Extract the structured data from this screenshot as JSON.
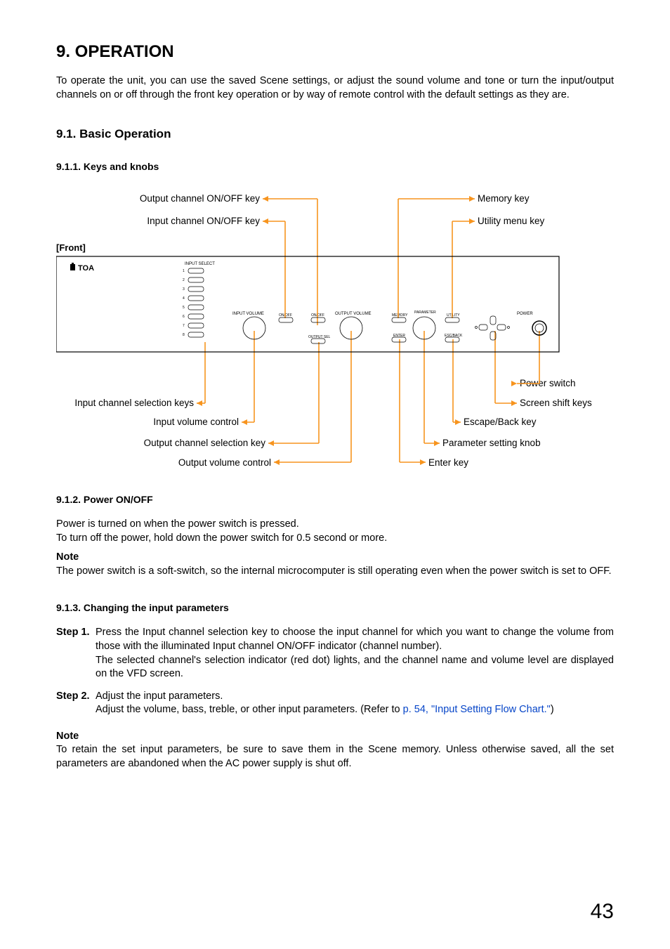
{
  "title": "9. OPERATION",
  "intro": "To operate the unit, you can use the saved Scene settings, or adjust the sound volume and tone or turn the input/output channels on or off through the front key operation or by way of remote control with the default settings as they are.",
  "s91": "9.1. Basic Operation",
  "s911": "9.1.1. Keys and knobs",
  "diagram": {
    "front": "[Front]",
    "brand": "TOA",
    "labels": {
      "outChOnOff": "Output channel ON/OFF key",
      "inChOnOff": "Input channel ON/OFF key",
      "memoryKey": "Memory key",
      "utilityKey": "Utility menu key",
      "inChSel": "Input channel selection keys",
      "inVol": "Input volume control",
      "outChSel": "Output channel selection key",
      "outVol": "Output volume control",
      "powerSw": "Power switch",
      "screenShift": "Screen shift keys",
      "escBack": "Escape/Back key",
      "paramKnob": "Parameter setting knob",
      "enterKey": "Enter key"
    },
    "panel": {
      "inputSelect": "INPUT SELECT",
      "nums": [
        "1",
        "2",
        "3",
        "4",
        "5",
        "6",
        "7",
        "8"
      ],
      "inputVolume": "INPUT VOLUME",
      "onOffL": "ON/OFF",
      "onOffR": "ON/OFF",
      "outputVolume": "OUTPUT VOLUME",
      "outputSel": "OUTPUT SEL",
      "memory": "MEMORY",
      "parameter": "PARAMETER",
      "utility": "UTILITY",
      "enter": "ENTER",
      "escBack": "ESC/BACK",
      "power": "POWER"
    }
  },
  "s912": "9.1.2. Power ON/OFF",
  "s912_p1": "Power is turned on when the power switch is pressed.",
  "s912_p2": "To turn off the power, hold down  the power switch for 0.5 second or more.",
  "noteHd": "Note",
  "s912_note": "The power switch is a soft-switch, so the internal microcomputer is still operating even when the power switch is set to OFF.",
  "s913": "9.1.3. Changing the input parameters",
  "step1Label": "Step 1.",
  "step1a": "Press the Input channel selection key to choose the input channel for which you want to change the volume from those with the illuminated Input channel ON/OFF indicator (channel number).",
  "step1b": "The selected channel's selection indicator (red dot) lights, and the channel name and volume level are displayed on the VFD screen.",
  "step2Label": "Step 2.",
  "step2a": "Adjust the input parameters.",
  "step2b_pre": "Adjust the volume, bass, treble, or other input parameters. (Refer to ",
  "step2b_link": "p. 54, \"Input Setting Flow Chart.\"",
  "step2b_post": ")",
  "s913_note": "To retain the set input parameters, be sure to save them in the Scene memory. Unless otherwise saved, all the set parameters are abandoned when the AC power supply is shut off.",
  "pageNum": "43"
}
